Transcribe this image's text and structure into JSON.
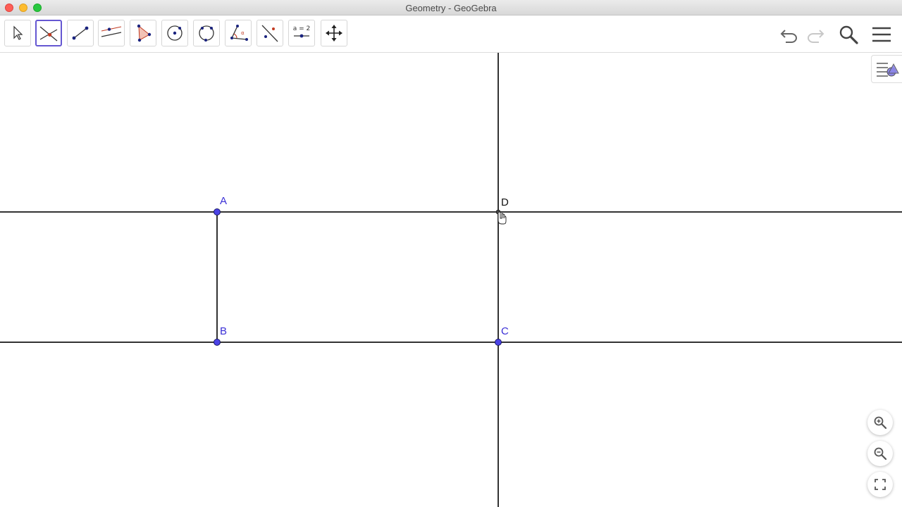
{
  "window": {
    "title": "Geometry - GeoGebra"
  },
  "toolbar": {
    "tools": [
      {
        "name": "move-tool",
        "icon": "arrow-pointer-icon"
      },
      {
        "name": "intersect-tool",
        "icon": "intersect-icon",
        "selected": true
      },
      {
        "name": "segment-tool",
        "icon": "segment-icon"
      },
      {
        "name": "parallel-line-tool",
        "icon": "parallel-line-icon"
      },
      {
        "name": "polygon-tool",
        "icon": "polygon-icon"
      },
      {
        "name": "circle-center-point-tool",
        "icon": "circle-center-icon"
      },
      {
        "name": "circle-three-points-tool",
        "icon": "circle-three-points-icon"
      },
      {
        "name": "angle-tool",
        "icon": "angle-icon"
      },
      {
        "name": "reflect-tool",
        "icon": "reflect-line-icon"
      },
      {
        "name": "slider-tool",
        "icon": "slider-icon",
        "label": "a = 2"
      },
      {
        "name": "move-graphics-tool",
        "icon": "move-cross-icon"
      }
    ],
    "undo_icon": "undo-icon",
    "redo_icon": "redo-icon",
    "search_icon": "search-icon",
    "menu_icon": "hamburger-menu-icon"
  },
  "graphics": {
    "points": [
      {
        "name": "A",
        "label": "A"
      },
      {
        "name": "B",
        "label": "B"
      },
      {
        "name": "C",
        "label": "C"
      },
      {
        "name": "D",
        "label": "D"
      }
    ],
    "colors": {
      "point": "#4b43e6",
      "line": "#333333",
      "label": "#3a2fd6"
    }
  },
  "zoom": {
    "zoom_in_icon": "zoom-in-icon",
    "zoom_out_icon": "zoom-out-icon",
    "fullscreen_icon": "fullscreen-icon"
  }
}
